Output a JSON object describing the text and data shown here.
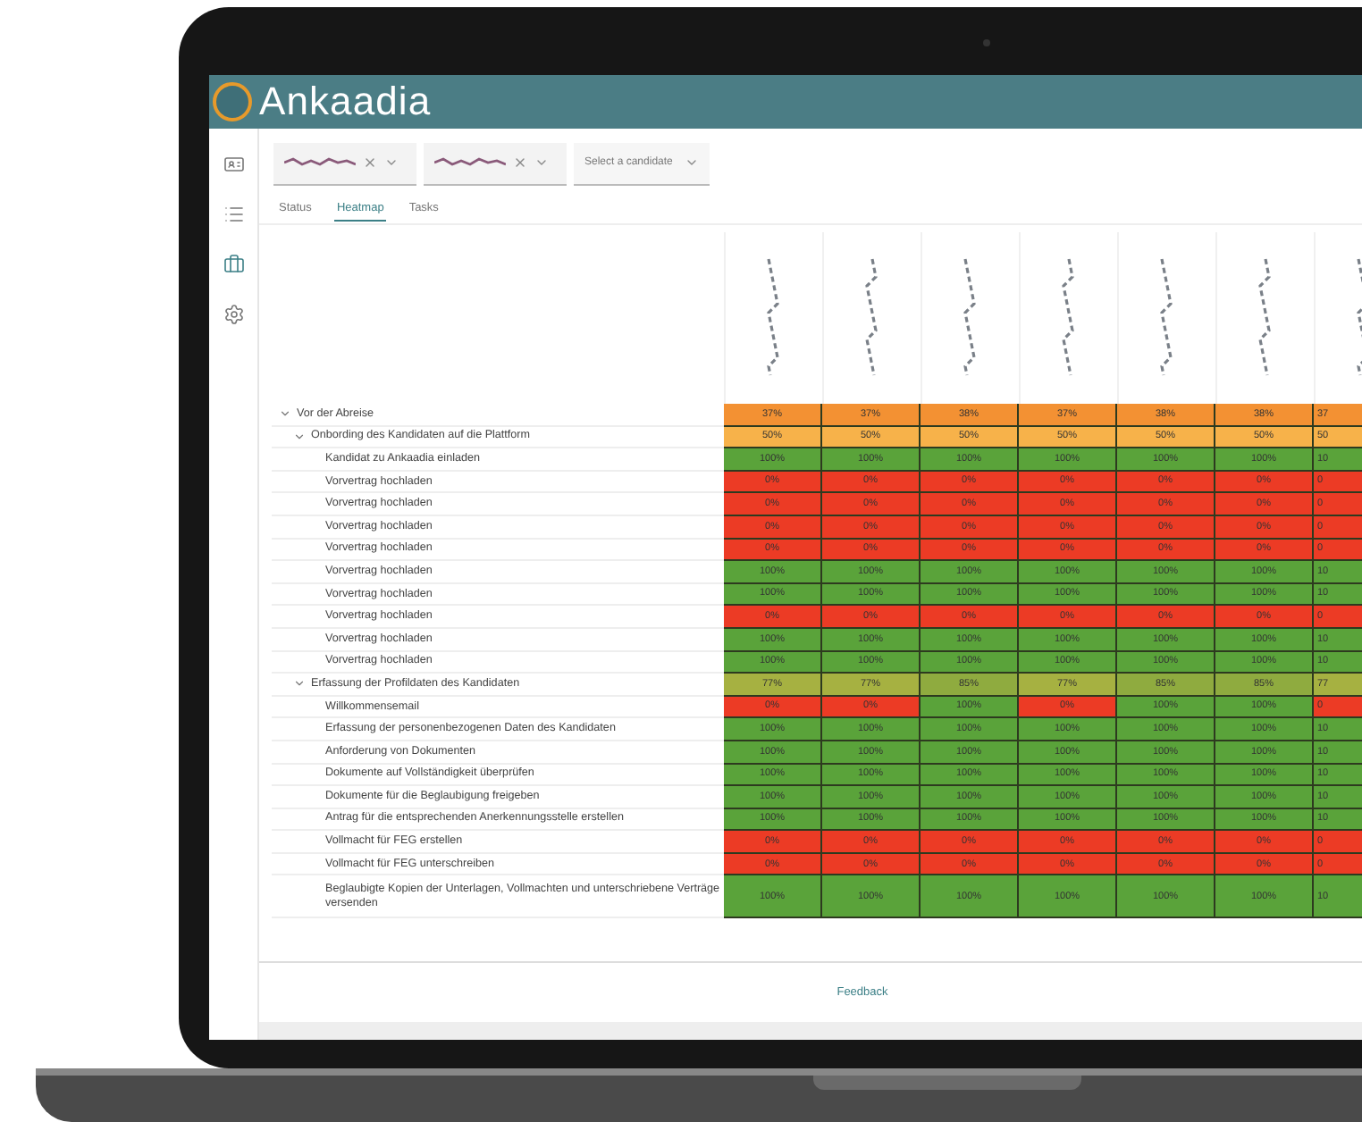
{
  "app": {
    "logo_text": "Ankaadia"
  },
  "sidebar": {
    "items": [
      {
        "selected": false
      },
      {
        "selected": false
      },
      {
        "selected": true
      },
      {
        "selected": false
      }
    ]
  },
  "filters": [
    {
      "kind": "chip"
    },
    {
      "kind": "chip"
    },
    {
      "kind": "select",
      "placeholder": "Select a candidate"
    }
  ],
  "tabs": [
    {
      "label": "Status",
      "selected": false
    },
    {
      "label": "Heatmap",
      "selected": true
    },
    {
      "label": "Tasks",
      "selected": false
    }
  ],
  "heatmap": {
    "rows": [
      {
        "label": "Vor der Abreise",
        "expanded": true,
        "cells": [
          {
            "value": "37%",
            "color": "#f39133"
          },
          {
            "value": "37%",
            "color": "#f39133"
          },
          {
            "value": "38%",
            "color": "#f39133"
          },
          {
            "value": "37%",
            "color": "#f39133"
          },
          {
            "value": "38%",
            "color": "#f39133"
          },
          {
            "value": "38%",
            "color": "#f39133"
          },
          {
            "value": "37",
            "color": "#f39133"
          }
        ],
        "children": [
          {
            "label": "Onbording des Kandidaten auf die Plattform",
            "expanded": true,
            "cells": [
              {
                "value": "50%",
                "color": "#f7b24a"
              },
              {
                "value": "50%",
                "color": "#f7b24a"
              },
              {
                "value": "50%",
                "color": "#f7b24a"
              },
              {
                "value": "50%",
                "color": "#f7b24a"
              },
              {
                "value": "50%",
                "color": "#f7b24a"
              },
              {
                "value": "50%",
                "color": "#f7b24a"
              },
              {
                "value": "50",
                "color": "#f7b24a"
              }
            ],
            "children": [
              {
                "label": "Kandidat zu Ankaadia einladen",
                "cells": [
                  {
                    "value": "100%",
                    "color": "#5aa33a"
                  },
                  {
                    "value": "100%",
                    "color": "#5aa33a"
                  },
                  {
                    "value": "100%",
                    "color": "#5aa33a"
                  },
                  {
                    "value": "100%",
                    "color": "#5aa33a"
                  },
                  {
                    "value": "100%",
                    "color": "#5aa33a"
                  },
                  {
                    "value": "100%",
                    "color": "#5aa33a"
                  },
                  {
                    "value": "10",
                    "color": "#5aa33a"
                  }
                ]
              },
              {
                "label": "Vorvertrag hochladen",
                "cells": [
                  {
                    "value": "0%",
                    "color": "#ec3b25"
                  },
                  {
                    "value": "0%",
                    "color": "#ec3b25"
                  },
                  {
                    "value": "0%",
                    "color": "#ec3b25"
                  },
                  {
                    "value": "0%",
                    "color": "#ec3b25"
                  },
                  {
                    "value": "0%",
                    "color": "#ec3b25"
                  },
                  {
                    "value": "0%",
                    "color": "#ec3b25"
                  },
                  {
                    "value": "0",
                    "color": "#ec3b25"
                  }
                ]
              },
              {
                "label": "Vorvertrag hochladen",
                "cells": [
                  {
                    "value": "0%",
                    "color": "#ec3b25"
                  },
                  {
                    "value": "0%",
                    "color": "#ec3b25"
                  },
                  {
                    "value": "0%",
                    "color": "#ec3b25"
                  },
                  {
                    "value": "0%",
                    "color": "#ec3b25"
                  },
                  {
                    "value": "0%",
                    "color": "#ec3b25"
                  },
                  {
                    "value": "0%",
                    "color": "#ec3b25"
                  },
                  {
                    "value": "0",
                    "color": "#ec3b25"
                  }
                ]
              },
              {
                "label": "Vorvertrag hochladen",
                "cells": [
                  {
                    "value": "0%",
                    "color": "#ec3b25"
                  },
                  {
                    "value": "0%",
                    "color": "#ec3b25"
                  },
                  {
                    "value": "0%",
                    "color": "#ec3b25"
                  },
                  {
                    "value": "0%",
                    "color": "#ec3b25"
                  },
                  {
                    "value": "0%",
                    "color": "#ec3b25"
                  },
                  {
                    "value": "0%",
                    "color": "#ec3b25"
                  },
                  {
                    "value": "0",
                    "color": "#ec3b25"
                  }
                ]
              },
              {
                "label": "Vorvertrag hochladen",
                "cells": [
                  {
                    "value": "0%",
                    "color": "#ec3b25"
                  },
                  {
                    "value": "0%",
                    "color": "#ec3b25"
                  },
                  {
                    "value": "0%",
                    "color": "#ec3b25"
                  },
                  {
                    "value": "0%",
                    "color": "#ec3b25"
                  },
                  {
                    "value": "0%",
                    "color": "#ec3b25"
                  },
                  {
                    "value": "0%",
                    "color": "#ec3b25"
                  },
                  {
                    "value": "0",
                    "color": "#ec3b25"
                  }
                ]
              },
              {
                "label": "Vorvertrag hochladen",
                "cells": [
                  {
                    "value": "100%",
                    "color": "#5aa33a"
                  },
                  {
                    "value": "100%",
                    "color": "#5aa33a"
                  },
                  {
                    "value": "100%",
                    "color": "#5aa33a"
                  },
                  {
                    "value": "100%",
                    "color": "#5aa33a"
                  },
                  {
                    "value": "100%",
                    "color": "#5aa33a"
                  },
                  {
                    "value": "100%",
                    "color": "#5aa33a"
                  },
                  {
                    "value": "10",
                    "color": "#5aa33a"
                  }
                ]
              },
              {
                "label": "Vorvertrag hochladen",
                "cells": [
                  {
                    "value": "100%",
                    "color": "#5aa33a"
                  },
                  {
                    "value": "100%",
                    "color": "#5aa33a"
                  },
                  {
                    "value": "100%",
                    "color": "#5aa33a"
                  },
                  {
                    "value": "100%",
                    "color": "#5aa33a"
                  },
                  {
                    "value": "100%",
                    "color": "#5aa33a"
                  },
                  {
                    "value": "100%",
                    "color": "#5aa33a"
                  },
                  {
                    "value": "10",
                    "color": "#5aa33a"
                  }
                ]
              },
              {
                "label": "Vorvertrag hochladen",
                "cells": [
                  {
                    "value": "0%",
                    "color": "#ec3b25"
                  },
                  {
                    "value": "0%",
                    "color": "#ec3b25"
                  },
                  {
                    "value": "0%",
                    "color": "#ec3b25"
                  },
                  {
                    "value": "0%",
                    "color": "#ec3b25"
                  },
                  {
                    "value": "0%",
                    "color": "#ec3b25"
                  },
                  {
                    "value": "0%",
                    "color": "#ec3b25"
                  },
                  {
                    "value": "0",
                    "color": "#ec3b25"
                  }
                ]
              },
              {
                "label": "Vorvertrag hochladen",
                "cells": [
                  {
                    "value": "100%",
                    "color": "#5aa33a"
                  },
                  {
                    "value": "100%",
                    "color": "#5aa33a"
                  },
                  {
                    "value": "100%",
                    "color": "#5aa33a"
                  },
                  {
                    "value": "100%",
                    "color": "#5aa33a"
                  },
                  {
                    "value": "100%",
                    "color": "#5aa33a"
                  },
                  {
                    "value": "100%",
                    "color": "#5aa33a"
                  },
                  {
                    "value": "10",
                    "color": "#5aa33a"
                  }
                ]
              },
              {
                "label": "Vorvertrag hochladen",
                "cells": [
                  {
                    "value": "100%",
                    "color": "#5aa33a"
                  },
                  {
                    "value": "100%",
                    "color": "#5aa33a"
                  },
                  {
                    "value": "100%",
                    "color": "#5aa33a"
                  },
                  {
                    "value": "100%",
                    "color": "#5aa33a"
                  },
                  {
                    "value": "100%",
                    "color": "#5aa33a"
                  },
                  {
                    "value": "100%",
                    "color": "#5aa33a"
                  },
                  {
                    "value": "10",
                    "color": "#5aa33a"
                  }
                ]
              }
            ]
          },
          {
            "label": "Erfassung der Profildaten des Kandidaten",
            "expanded": true,
            "cells": [
              {
                "value": "77%",
                "color": "#a6b141"
              },
              {
                "value": "77%",
                "color": "#a6b141"
              },
              {
                "value": "85%",
                "color": "#8fab3f"
              },
              {
                "value": "77%",
                "color": "#a6b141"
              },
              {
                "value": "85%",
                "color": "#8fab3f"
              },
              {
                "value": "85%",
                "color": "#8fab3f"
              },
              {
                "value": "77",
                "color": "#a6b141"
              }
            ],
            "children": [
              {
                "label": "Willkommensemail",
                "cells": [
                  {
                    "value": "0%",
                    "color": "#ec3b25"
                  },
                  {
                    "value": "0%",
                    "color": "#ec3b25"
                  },
                  {
                    "value": "100%",
                    "color": "#5aa33a"
                  },
                  {
                    "value": "0%",
                    "color": "#ec3b25"
                  },
                  {
                    "value": "100%",
                    "color": "#5aa33a"
                  },
                  {
                    "value": "100%",
                    "color": "#5aa33a"
                  },
                  {
                    "value": "0",
                    "color": "#ec3b25"
                  }
                ]
              },
              {
                "label": "Erfassung der personenbezogenen Daten des Kandidaten",
                "cells": [
                  {
                    "value": "100%",
                    "color": "#5aa33a"
                  },
                  {
                    "value": "100%",
                    "color": "#5aa33a"
                  },
                  {
                    "value": "100%",
                    "color": "#5aa33a"
                  },
                  {
                    "value": "100%",
                    "color": "#5aa33a"
                  },
                  {
                    "value": "100%",
                    "color": "#5aa33a"
                  },
                  {
                    "value": "100%",
                    "color": "#5aa33a"
                  },
                  {
                    "value": "10",
                    "color": "#5aa33a"
                  }
                ]
              },
              {
                "label": "Anforderung von Dokumenten",
                "cells": [
                  {
                    "value": "100%",
                    "color": "#5aa33a"
                  },
                  {
                    "value": "100%",
                    "color": "#5aa33a"
                  },
                  {
                    "value": "100%",
                    "color": "#5aa33a"
                  },
                  {
                    "value": "100%",
                    "color": "#5aa33a"
                  },
                  {
                    "value": "100%",
                    "color": "#5aa33a"
                  },
                  {
                    "value": "100%",
                    "color": "#5aa33a"
                  },
                  {
                    "value": "10",
                    "color": "#5aa33a"
                  }
                ]
              },
              {
                "label": "Dokumente auf Vollständigkeit überprüfen",
                "cells": [
                  {
                    "value": "100%",
                    "color": "#5aa33a"
                  },
                  {
                    "value": "100%",
                    "color": "#5aa33a"
                  },
                  {
                    "value": "100%",
                    "color": "#5aa33a"
                  },
                  {
                    "value": "100%",
                    "color": "#5aa33a"
                  },
                  {
                    "value": "100%",
                    "color": "#5aa33a"
                  },
                  {
                    "value": "100%",
                    "color": "#5aa33a"
                  },
                  {
                    "value": "10",
                    "color": "#5aa33a"
                  }
                ]
              },
              {
                "label": "Dokumente für die Beglaubigung freigeben",
                "cells": [
                  {
                    "value": "100%",
                    "color": "#5aa33a"
                  },
                  {
                    "value": "100%",
                    "color": "#5aa33a"
                  },
                  {
                    "value": "100%",
                    "color": "#5aa33a"
                  },
                  {
                    "value": "100%",
                    "color": "#5aa33a"
                  },
                  {
                    "value": "100%",
                    "color": "#5aa33a"
                  },
                  {
                    "value": "100%",
                    "color": "#5aa33a"
                  },
                  {
                    "value": "10",
                    "color": "#5aa33a"
                  }
                ]
              },
              {
                "label": "Antrag für die entsprechenden Anerkennungsstelle erstellen",
                "cells": [
                  {
                    "value": "100%",
                    "color": "#5aa33a"
                  },
                  {
                    "value": "100%",
                    "color": "#5aa33a"
                  },
                  {
                    "value": "100%",
                    "color": "#5aa33a"
                  },
                  {
                    "value": "100%",
                    "color": "#5aa33a"
                  },
                  {
                    "value": "100%",
                    "color": "#5aa33a"
                  },
                  {
                    "value": "100%",
                    "color": "#5aa33a"
                  },
                  {
                    "value": "10",
                    "color": "#5aa33a"
                  }
                ]
              },
              {
                "label": "Vollmacht für FEG erstellen",
                "cells": [
                  {
                    "value": "0%",
                    "color": "#ec3b25"
                  },
                  {
                    "value": "0%",
                    "color": "#ec3b25"
                  },
                  {
                    "value": "0%",
                    "color": "#ec3b25"
                  },
                  {
                    "value": "0%",
                    "color": "#ec3b25"
                  },
                  {
                    "value": "0%",
                    "color": "#ec3b25"
                  },
                  {
                    "value": "0%",
                    "color": "#ec3b25"
                  },
                  {
                    "value": "0",
                    "color": "#ec3b25"
                  }
                ]
              },
              {
                "label": "Vollmacht für FEG unterschreiben",
                "cells": [
                  {
                    "value": "0%",
                    "color": "#ec3b25"
                  },
                  {
                    "value": "0%",
                    "color": "#ec3b25"
                  },
                  {
                    "value": "0%",
                    "color": "#ec3b25"
                  },
                  {
                    "value": "0%",
                    "color": "#ec3b25"
                  },
                  {
                    "value": "0%",
                    "color": "#ec3b25"
                  },
                  {
                    "value": "0%",
                    "color": "#ec3b25"
                  },
                  {
                    "value": "0",
                    "color": "#ec3b25"
                  }
                ]
              },
              {
                "label": "Beglaubigte Kopien der Unterlagen, Vollmachten und unterschriebene Verträge versenden",
                "cells": [
                  {
                    "value": "100%",
                    "color": "#5aa33a"
                  },
                  {
                    "value": "100%",
                    "color": "#5aa33a"
                  },
                  {
                    "value": "100%",
                    "color": "#5aa33a"
                  },
                  {
                    "value": "100%",
                    "color": "#5aa33a"
                  },
                  {
                    "value": "100%",
                    "color": "#5aa33a"
                  },
                  {
                    "value": "100%",
                    "color": "#5aa33a"
                  },
                  {
                    "value": "10",
                    "color": "#5aa33a"
                  }
                ]
              }
            ]
          }
        ]
      }
    ]
  },
  "footer": {
    "link": "Feedback"
  }
}
